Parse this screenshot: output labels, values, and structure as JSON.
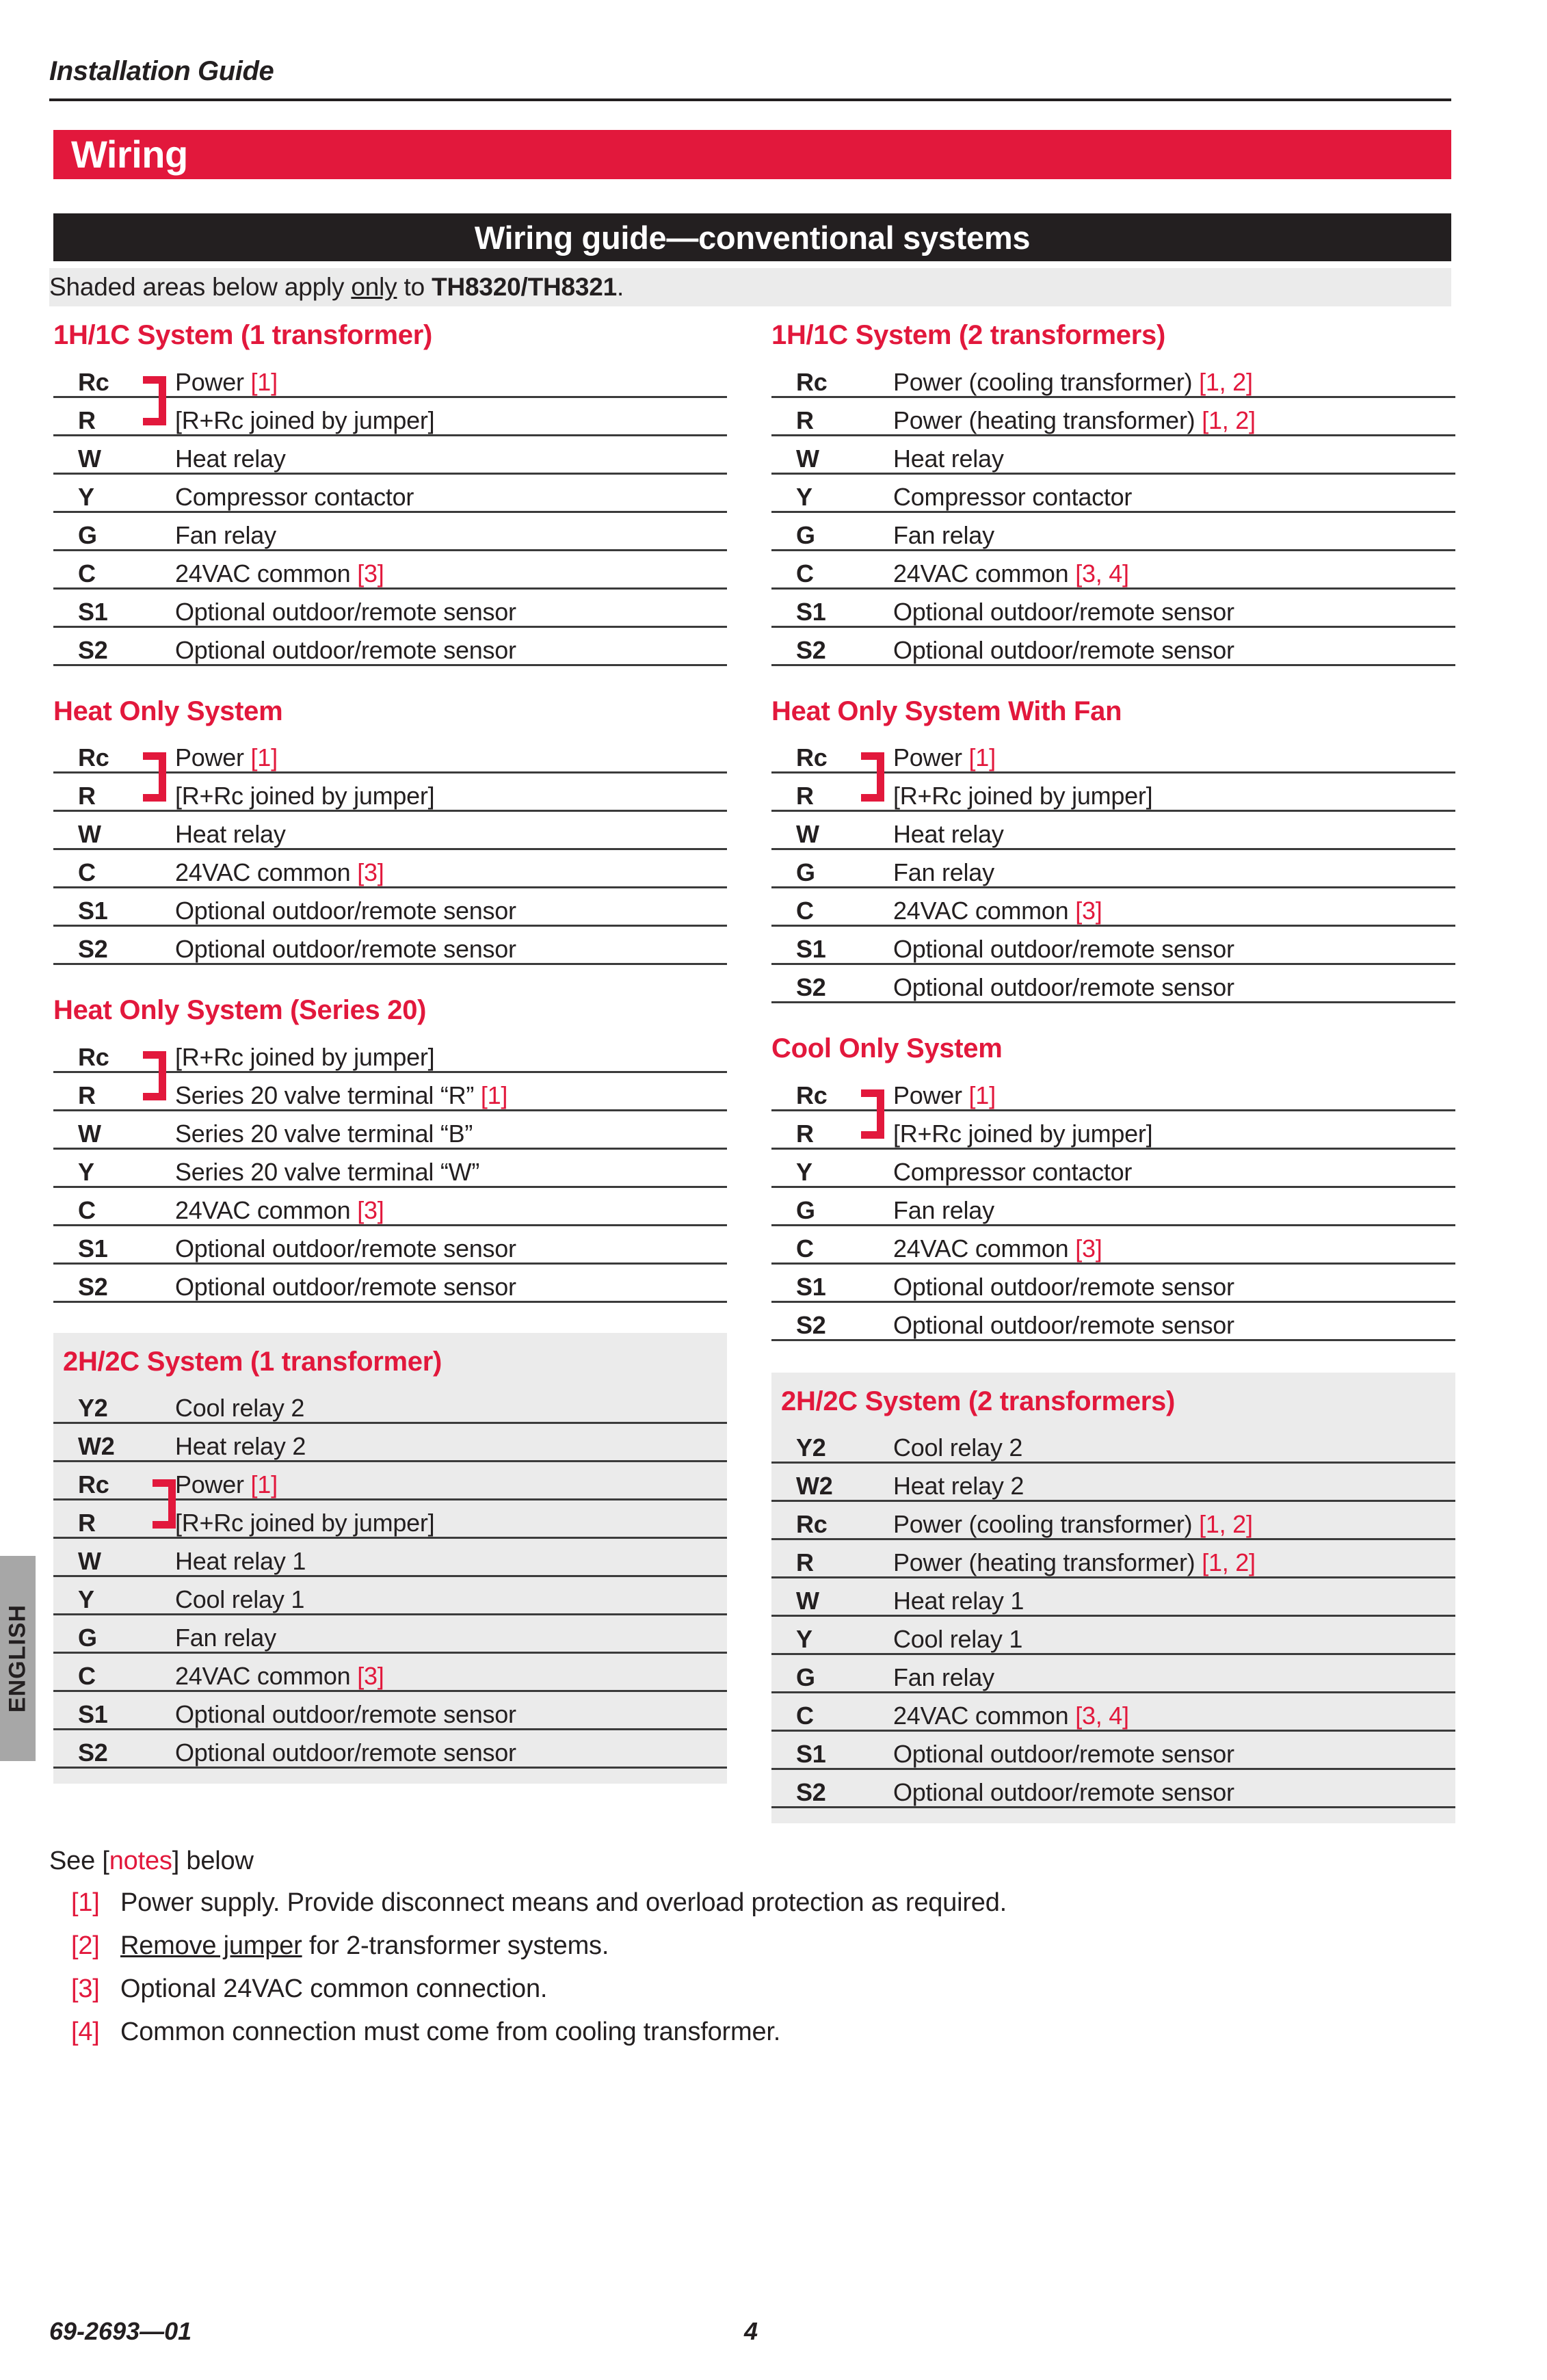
{
  "running_head": "Installation Guide",
  "chapter": {
    "title": "Wiring"
  },
  "section": {
    "title": "Wiring guide—conventional systems"
  },
  "intro_note": {
    "part1": "Shaded areas below apply ",
    "underlined": "only",
    "part2": " to ",
    "bold": "TH8320/TH8321",
    "part3": "."
  },
  "side_tab": {
    "label": "ENGLISH"
  },
  "colors": {
    "accent_red": "#e2183c",
    "banner_black": "#231f20",
    "shade_gray": "#ebebeb",
    "tab_gray": "#a7a7a7",
    "rule_gray": "#3b3b3b"
  },
  "blocks": {
    "h1c_1t": {
      "title": "1H/1C System (1 transformer)",
      "jumper": true,
      "shaded": false,
      "rows": [
        {
          "term": "Rc",
          "desc": "Power ",
          "ref": "[1]"
        },
        {
          "term": "R",
          "desc": "[R+Rc joined by jumper]",
          "ref": ""
        },
        {
          "term": "W",
          "desc": "Heat relay",
          "ref": ""
        },
        {
          "term": "Y",
          "desc": "Compressor contactor",
          "ref": ""
        },
        {
          "term": "G",
          "desc": "Fan relay",
          "ref": ""
        },
        {
          "term": "C",
          "desc": "24VAC common ",
          "ref": "[3]"
        },
        {
          "term": "S1",
          "desc": "Optional outdoor/remote sensor",
          "ref": ""
        },
        {
          "term": "S2",
          "desc": "Optional outdoor/remote sensor",
          "ref": ""
        }
      ]
    },
    "h1c_2t": {
      "title": "1H/1C System (2 transformers)",
      "jumper": false,
      "shaded": false,
      "rows": [
        {
          "term": "Rc",
          "desc": "Power (cooling transformer) ",
          "ref": "[1, 2]"
        },
        {
          "term": "R",
          "desc": "Power (heating transformer) ",
          "ref": "[1, 2]"
        },
        {
          "term": "W",
          "desc": "Heat relay",
          "ref": ""
        },
        {
          "term": "Y",
          "desc": "Compressor contactor",
          "ref": ""
        },
        {
          "term": "G",
          "desc": "Fan relay",
          "ref": ""
        },
        {
          "term": "C",
          "desc": "24VAC common ",
          "ref": "[3, 4]"
        },
        {
          "term": "S1",
          "desc": "Optional outdoor/remote sensor",
          "ref": ""
        },
        {
          "term": "S2",
          "desc": "Optional outdoor/remote sensor",
          "ref": ""
        }
      ]
    },
    "heat_only": {
      "title": "Heat Only System",
      "jumper": true,
      "shaded": false,
      "rows": [
        {
          "term": "Rc",
          "desc": "Power ",
          "ref": "[1]"
        },
        {
          "term": "R",
          "desc": "[R+Rc joined by jumper]",
          "ref": ""
        },
        {
          "term": "W",
          "desc": "Heat relay",
          "ref": ""
        },
        {
          "term": "C",
          "desc": "24VAC common ",
          "ref": "[3]"
        },
        {
          "term": "S1",
          "desc": "Optional outdoor/remote sensor",
          "ref": ""
        },
        {
          "term": "S2",
          "desc": "Optional outdoor/remote sensor",
          "ref": ""
        }
      ]
    },
    "heat_only_fan": {
      "title": "Heat Only System With Fan",
      "jumper": true,
      "shaded": false,
      "rows": [
        {
          "term": "Rc",
          "desc": "Power ",
          "ref": "[1]"
        },
        {
          "term": "R",
          "desc": "[R+Rc joined by jumper]",
          "ref": ""
        },
        {
          "term": "W",
          "desc": "Heat relay",
          "ref": ""
        },
        {
          "term": "G",
          "desc": "Fan relay",
          "ref": ""
        },
        {
          "term": "C",
          "desc": "24VAC common ",
          "ref": "[3]"
        },
        {
          "term": "S1",
          "desc": "Optional outdoor/remote sensor",
          "ref": ""
        },
        {
          "term": "S2",
          "desc": "Optional outdoor/remote sensor",
          "ref": ""
        }
      ]
    },
    "heat_only_s20": {
      "title": "Heat Only System (Series 20)",
      "jumper": true,
      "shaded": false,
      "rows": [
        {
          "term": "Rc",
          "desc": "[R+Rc joined by jumper]",
          "ref": ""
        },
        {
          "term": "R",
          "desc": "Series 20 valve terminal “R” ",
          "ref": "[1]"
        },
        {
          "term": "W",
          "desc": "Series 20 valve terminal “B”",
          "ref": ""
        },
        {
          "term": "Y",
          "desc": "Series 20 valve terminal “W”",
          "ref": ""
        },
        {
          "term": "C",
          "desc": "24VAC common ",
          "ref": "[3]"
        },
        {
          "term": "S1",
          "desc": "Optional outdoor/remote sensor",
          "ref": ""
        },
        {
          "term": "S2",
          "desc": "Optional outdoor/remote sensor",
          "ref": ""
        }
      ]
    },
    "cool_only": {
      "title": "Cool Only System",
      "jumper": true,
      "shaded": false,
      "rows": [
        {
          "term": "Rc",
          "desc": "Power ",
          "ref": "[1]"
        },
        {
          "term": "R",
          "desc": "[R+Rc joined by jumper]",
          "ref": ""
        },
        {
          "term": "Y",
          "desc": "Compressor contactor",
          "ref": ""
        },
        {
          "term": "G",
          "desc": "Fan relay",
          "ref": ""
        },
        {
          "term": "C",
          "desc": "24VAC common ",
          "ref": "[3]"
        },
        {
          "term": "S1",
          "desc": "Optional outdoor/remote sensor",
          "ref": ""
        },
        {
          "term": "S2",
          "desc": "Optional outdoor/remote sensor",
          "ref": ""
        }
      ]
    },
    "h2c_1t": {
      "title": "2H/2C System (1 transformer)",
      "jumper": true,
      "shaded": true,
      "rows": [
        {
          "term": "Y2",
          "desc": "Cool relay 2",
          "ref": ""
        },
        {
          "term": "W2",
          "desc": "Heat relay 2",
          "ref": ""
        },
        {
          "term": "Rc",
          "desc": "Power ",
          "ref": "[1]"
        },
        {
          "term": "R",
          "desc": "[R+Rc joined by jumper]",
          "ref": ""
        },
        {
          "term": "W",
          "desc": "Heat relay 1",
          "ref": ""
        },
        {
          "term": "Y",
          "desc": "Cool relay 1",
          "ref": ""
        },
        {
          "term": "G",
          "desc": "Fan relay",
          "ref": ""
        },
        {
          "term": "C",
          "desc": "24VAC common ",
          "ref": "[3]"
        },
        {
          "term": "S1",
          "desc": "Optional outdoor/remote sensor",
          "ref": ""
        },
        {
          "term": "S2",
          "desc": "Optional outdoor/remote sensor",
          "ref": ""
        }
      ]
    },
    "h2c_2t": {
      "title": "2H/2C System (2 transformers)",
      "jumper": false,
      "shaded": true,
      "rows": [
        {
          "term": "Y2",
          "desc": "Cool relay 2",
          "ref": ""
        },
        {
          "term": "W2",
          "desc": "Heat relay 2",
          "ref": ""
        },
        {
          "term": "Rc",
          "desc": "Power (cooling transformer) ",
          "ref": "[1, 2]"
        },
        {
          "term": "R",
          "desc": "Power (heating transformer) ",
          "ref": "[1, 2]"
        },
        {
          "term": "W",
          "desc": "Heat relay 1",
          "ref": ""
        },
        {
          "term": "Y",
          "desc": "Cool relay 1",
          "ref": ""
        },
        {
          "term": "G",
          "desc": "Fan relay",
          "ref": ""
        },
        {
          "term": "C",
          "desc": "24VAC common ",
          "ref": "[3, 4]"
        },
        {
          "term": "S1",
          "desc": "Optional outdoor/remote sensor",
          "ref": ""
        },
        {
          "term": "S2",
          "desc": "Optional outdoor/remote sensor",
          "ref": ""
        }
      ]
    }
  },
  "notes": {
    "lead_pre": "See [",
    "lead_red": "notes",
    "lead_post": "] below",
    "items": [
      {
        "marker": "[1]",
        "pre": "",
        "underlined": "",
        "post": "Power supply. Provide disconnect means and overload protection as required."
      },
      {
        "marker": "[2]",
        "pre": "",
        "underlined": "Remove jumper",
        "post": " for 2-transformer systems."
      },
      {
        "marker": "[3]",
        "pre": "",
        "underlined": "",
        "post": "Optional 24VAC common connection."
      },
      {
        "marker": "[4]",
        "pre": "",
        "underlined": "",
        "post": "Common connection must come from cooling transformer."
      }
    ]
  },
  "footer": {
    "doc_number": "69-2693—01",
    "page_number": "4"
  }
}
